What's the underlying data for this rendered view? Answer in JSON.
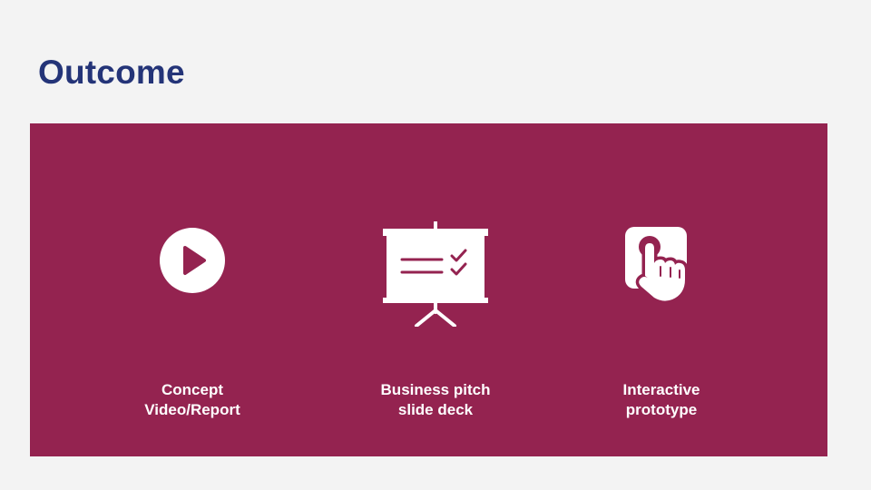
{
  "slide": {
    "title": "Outcome"
  },
  "colors": {
    "background": "#f3f3f3",
    "title": "#243478",
    "panel": "#942350",
    "foreground": "#ffffff"
  },
  "outcomes": [
    {
      "icon": "play-icon",
      "line1": "Concept",
      "line2": "Video/Report"
    },
    {
      "icon": "presentation-board-icon",
      "line1": "Business pitch",
      "line2": "slide deck"
    },
    {
      "icon": "touch-tap-icon",
      "line1": "Interactive",
      "line2": "prototype"
    }
  ]
}
